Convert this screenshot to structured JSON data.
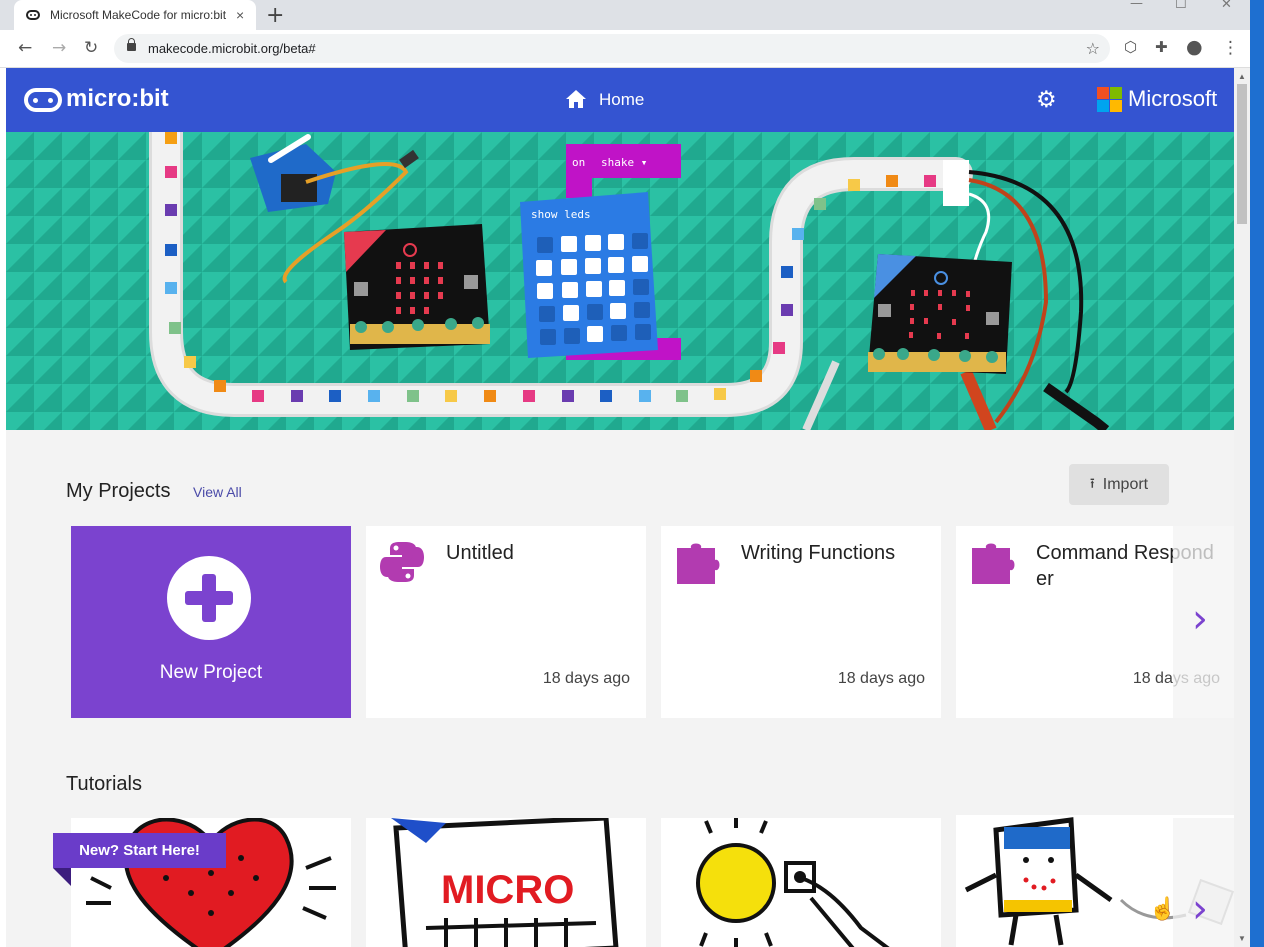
{
  "browser": {
    "tab_title": "Microsoft MakeCode for micro:bit",
    "tab_close": "×",
    "new_tab": "+",
    "url": "makecode.microbit.org/beta#",
    "win_minimize": "—",
    "win_maximize": "☐",
    "win_close": "✕"
  },
  "header": {
    "logo_text": "micro:bit",
    "home_label": "Home",
    "brand_text": "Microsoft",
    "ms_colors": [
      "#f25022",
      "#7fba00",
      "#00a4ef",
      "#ffb900"
    ],
    "header_color": "#3454d1"
  },
  "hero": {
    "block_event_on": "on",
    "block_event_value": "shake ▾",
    "block_show_leds": "show leds",
    "background": "#24b59a"
  },
  "projects": {
    "title": "My Projects",
    "view_all": "View All",
    "import_label": "Import",
    "new_project_label": "New Project",
    "cards": [
      {
        "title": "Untitled",
        "time": "18 days ago",
        "icon": "python-icon"
      },
      {
        "title": "Writing Functions",
        "time": "18 days ago",
        "icon": "puzzle-icon"
      },
      {
        "title": "Command Respond er",
        "time": "18 days ago",
        "icon": "puzzle-icon"
      }
    ],
    "next": "›"
  },
  "tutorials": {
    "title": "Tutorials",
    "ribbon": "New? Start Here!",
    "card2_text": "MICRO",
    "next": "›"
  }
}
